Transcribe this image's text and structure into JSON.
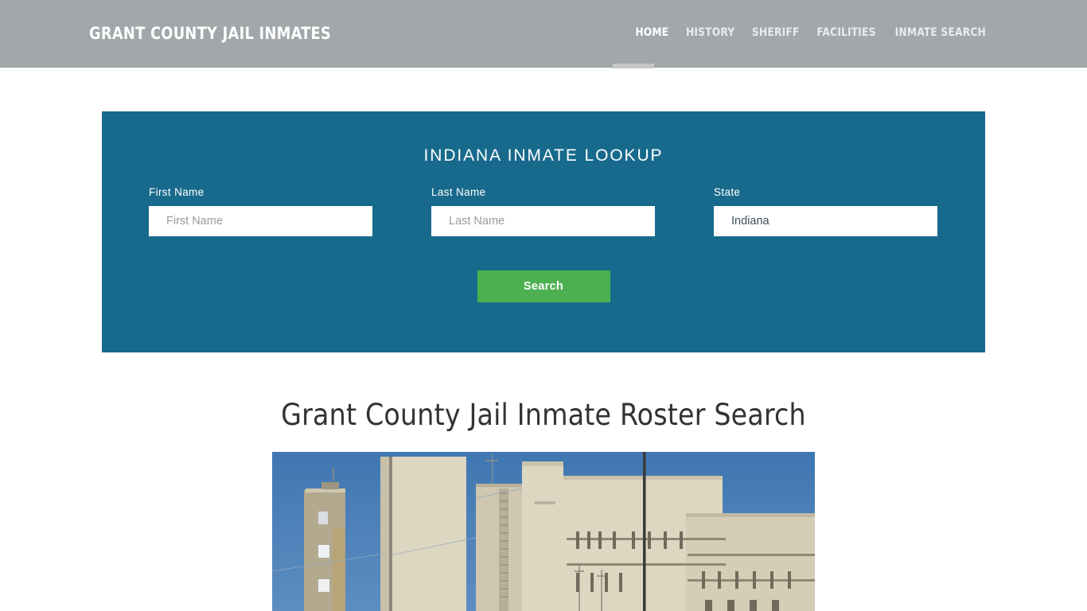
{
  "header": {
    "brand": "GRANT COUNTY JAIL INMATES",
    "nav": [
      {
        "label": "HOME",
        "active": true
      },
      {
        "label": "HISTORY",
        "active": false
      },
      {
        "label": "SHERIFF",
        "active": false
      },
      {
        "label": "FACILITIES",
        "active": false
      },
      {
        "label": "INMATE SEARCH",
        "active": false
      }
    ],
    "background_color": "#a2a7aa"
  },
  "lookup": {
    "title": "INDIANA INMATE LOOKUP",
    "panel_color": "#186a8c",
    "fields": [
      {
        "label": "First Name",
        "placeholder": "First Name",
        "value": ""
      },
      {
        "label": "Last Name",
        "placeholder": "Last Name",
        "value": ""
      },
      {
        "label": "State",
        "placeholder": "State",
        "value": "Indiana"
      }
    ],
    "search_label": "Search",
    "search_color": "#4cb050"
  },
  "main": {
    "page_title": "Grant County Jail Inmate Roster Search",
    "photo_alt": "Grant County Jail building exterior"
  }
}
